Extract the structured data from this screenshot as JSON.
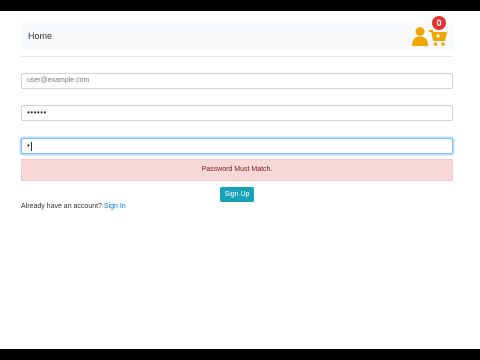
{
  "navbar": {
    "brand": "Home",
    "cart_count": "0",
    "icons": {
      "user": "user-icon",
      "cart": "shopping-cart-icon"
    },
    "colors": {
      "icon": "#f0a500",
      "badge": "#e3342f"
    }
  },
  "form": {
    "email": {
      "placeholder": "user@example.com",
      "value": ""
    },
    "password": {
      "value": "••••••"
    },
    "confirm_password": {
      "value": "•"
    },
    "alert": "Password Must Match.",
    "submit_label": "Sign Up",
    "signin_prompt": "Already have an account?",
    "signin_link": "Sign In"
  },
  "colors": {
    "alert_bg": "#f8d7da",
    "alert_text": "#721c24",
    "button_bg": "#17a2b8",
    "link": "#007bff"
  }
}
